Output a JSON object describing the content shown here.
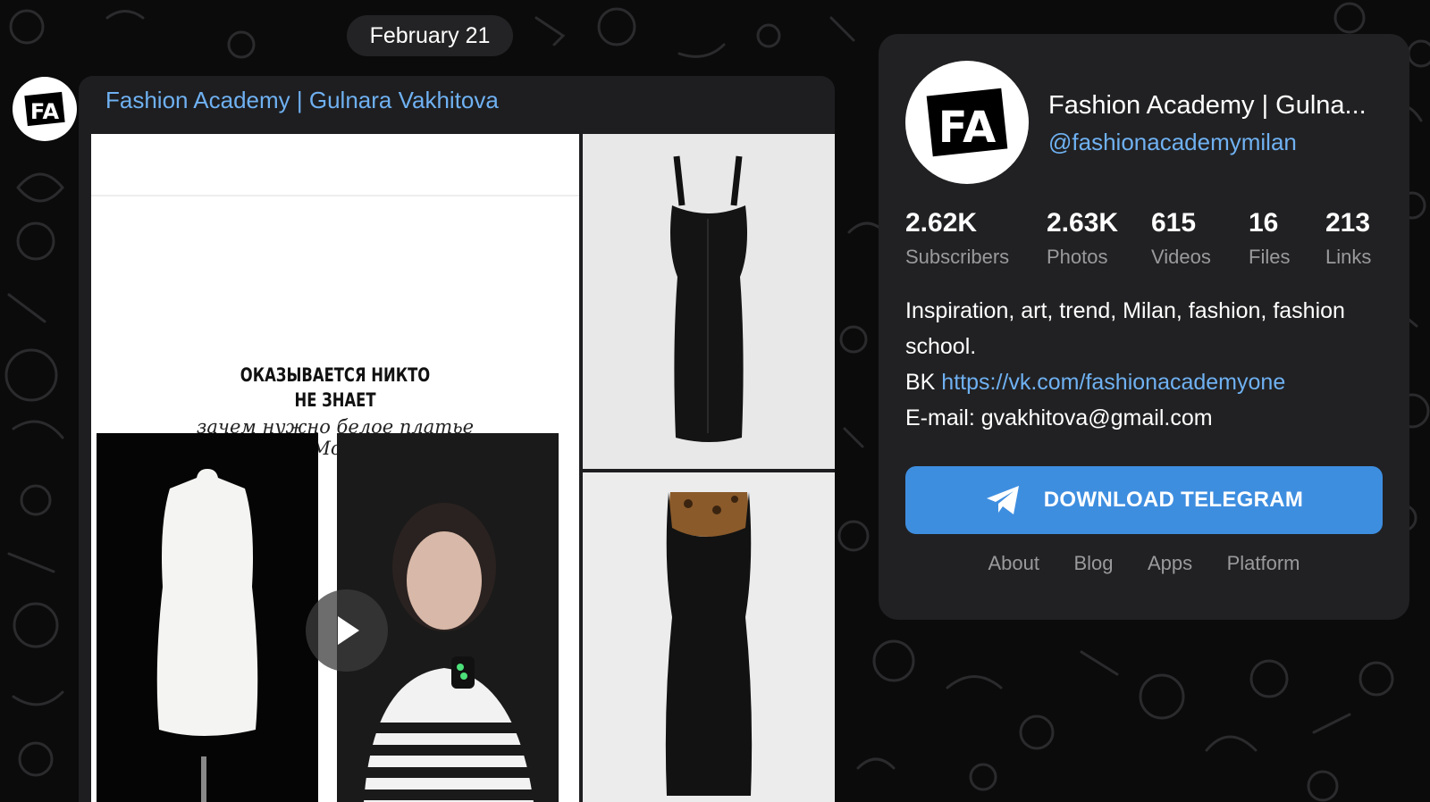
{
  "date_separator": "February 21",
  "message": {
    "author": "Fashion Academy | Gulnara Vakhitova",
    "collage": {
      "title_line1": "ОКАЗЫВАЕТСЯ НИКТО",
      "title_line2": "НЕ ЗНАЕТ",
      "script_line1": "зачем нужно белое платье",
      "script_line2": "на Монику"
    }
  },
  "logo_text": "FA",
  "channel": {
    "title": "Fashion Academy | Gulna...",
    "handle": "@fashionacademymilan",
    "stats": [
      {
        "value": "2.62K",
        "label": "Subscribers"
      },
      {
        "value": "2.63K",
        "label": "Photos"
      },
      {
        "value": "615",
        "label": "Videos"
      },
      {
        "value": "16",
        "label": "Files"
      },
      {
        "value": "213",
        "label": "Links"
      }
    ],
    "description": {
      "line1": "Inspiration, art, trend, Milan, fashion, fashion school.",
      "vk_prefix": "BK ",
      "vk_link": "https://vk.com/fashionacademyone",
      "email": "E-mail: gvakhitova@gmail.com"
    },
    "download_label": "DOWNLOAD TELEGRAM",
    "footer": [
      "About",
      "Blog",
      "Apps",
      "Platform"
    ]
  },
  "colors": {
    "accent": "#3e8ee0",
    "link": "#6fb1f2",
    "panel_bg": "#212123",
    "page_bg": "#0b0b0c"
  }
}
